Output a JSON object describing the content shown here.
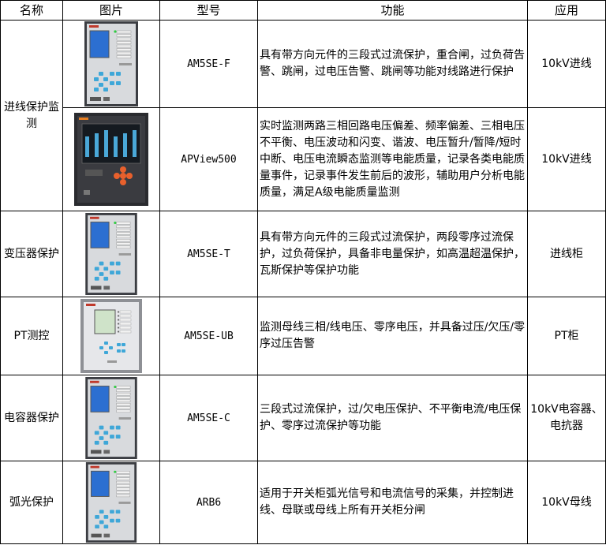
{
  "headers": {
    "name": "名称",
    "image": "图片",
    "model": "型号",
    "function": "功能",
    "application": "应用"
  },
  "groups": [
    {
      "name": "进线保护监测"
    },
    {
      "name": "变压器保护"
    },
    {
      "name": "PT测控"
    },
    {
      "name": "电容器保护"
    },
    {
      "name": "弧光保护"
    }
  ],
  "rows": [
    {
      "device": "am5se",
      "model": "AM5SE-F",
      "function": "具有带方向元件的三段式过流保护，重合闸，过负荷告警、跳闸，过电压告警、跳闸等功能对线路进行保护",
      "application": "10kV进线"
    },
    {
      "device": "apview",
      "model": "APView500",
      "function": "实时监测两路三相回路电压偏差、频率偏差、三相电压不平衡、电压波动和闪变、谐波、电压暂升/暂降/短时中断、电压电流瞬态监测等电能质量，记录各类电能质量事件，记录事件发生前后的波形，辅助用户分析电能质量，满足A级电能质量监测",
      "application": "10kV进线"
    },
    {
      "device": "am5se",
      "model": "AM5SE-T",
      "function": "具有带方向元件的三段式过流保护，两段零序过流保护，过负荷保护，具备非电量保护，如高温超温保护，瓦斯保护等保护功能",
      "application": "进线柜"
    },
    {
      "device": "am5se-ub",
      "model": "AM5SE-UB",
      "function": "监测母线三相/线电压、零序电压，并具备过压/欠压/零序过压告警",
      "application": "PT柜"
    },
    {
      "device": "am5se",
      "model": "AM5SE-C",
      "function": "三段式过流保护，过/欠电压保护、不平衡电流/电压保护、零序过流保护等功能",
      "application": "10kV电容器、电抗器"
    },
    {
      "device": "am5se",
      "model": "ARB6",
      "function": "适用于开关柜弧光信号和电流信号的采集，并控制进线、母联或母线上所有开关柜分闸",
      "application": "10kV母线"
    }
  ]
}
